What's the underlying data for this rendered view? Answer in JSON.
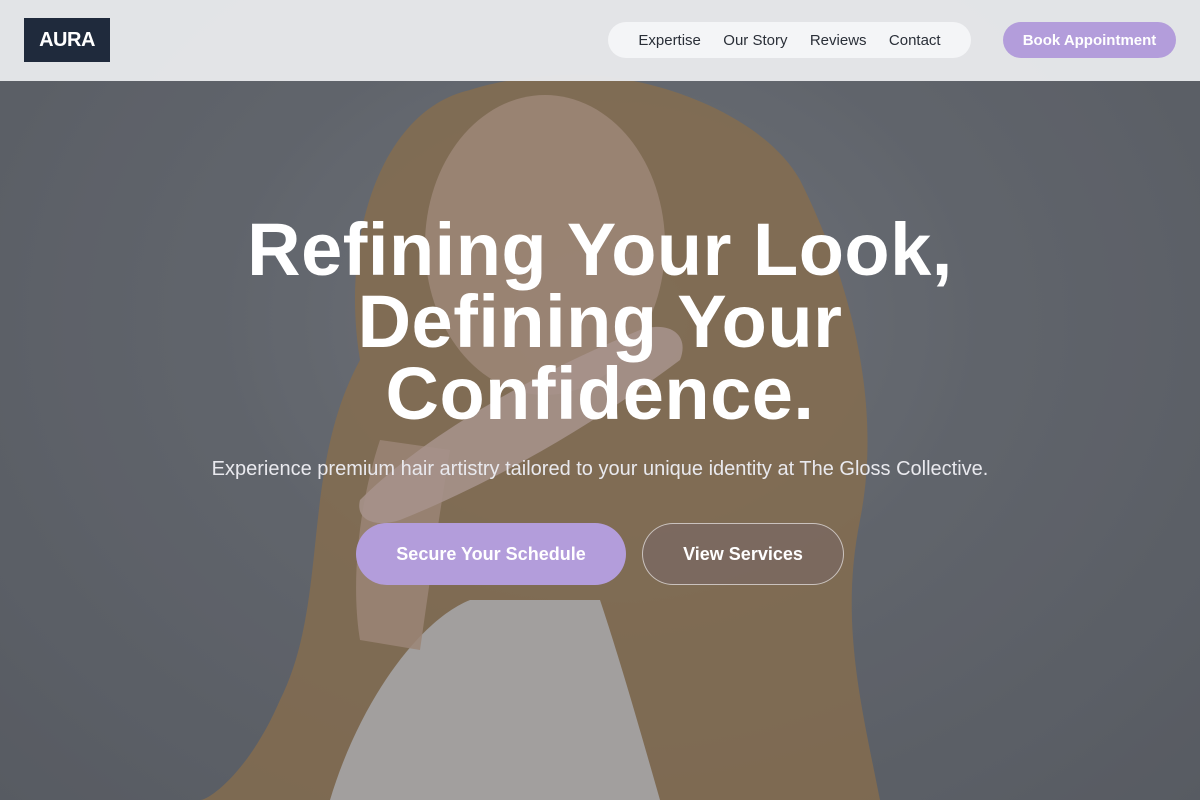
{
  "header": {
    "logo_text": "AURA",
    "nav": {
      "items": [
        {
          "label": "Expertise"
        },
        {
          "label": "Our Story"
        },
        {
          "label": "Reviews"
        },
        {
          "label": "Contact"
        }
      ]
    },
    "book_label": "Book Appointment"
  },
  "hero": {
    "headline": "Refining Your Look, Defining Your Confidence.",
    "subtitle": "Experience premium hair artistry tailored to your unique identity at The Gloss Collective.",
    "primary_cta": "Secure Your Schedule",
    "secondary_cta": "View Services"
  },
  "colors": {
    "accent": "#b39ddb",
    "logo_bg": "#1f2a3c",
    "header_bg": "#e8e9ec",
    "nav_bg": "#f4f5f7",
    "text_light": "#ffffff"
  }
}
